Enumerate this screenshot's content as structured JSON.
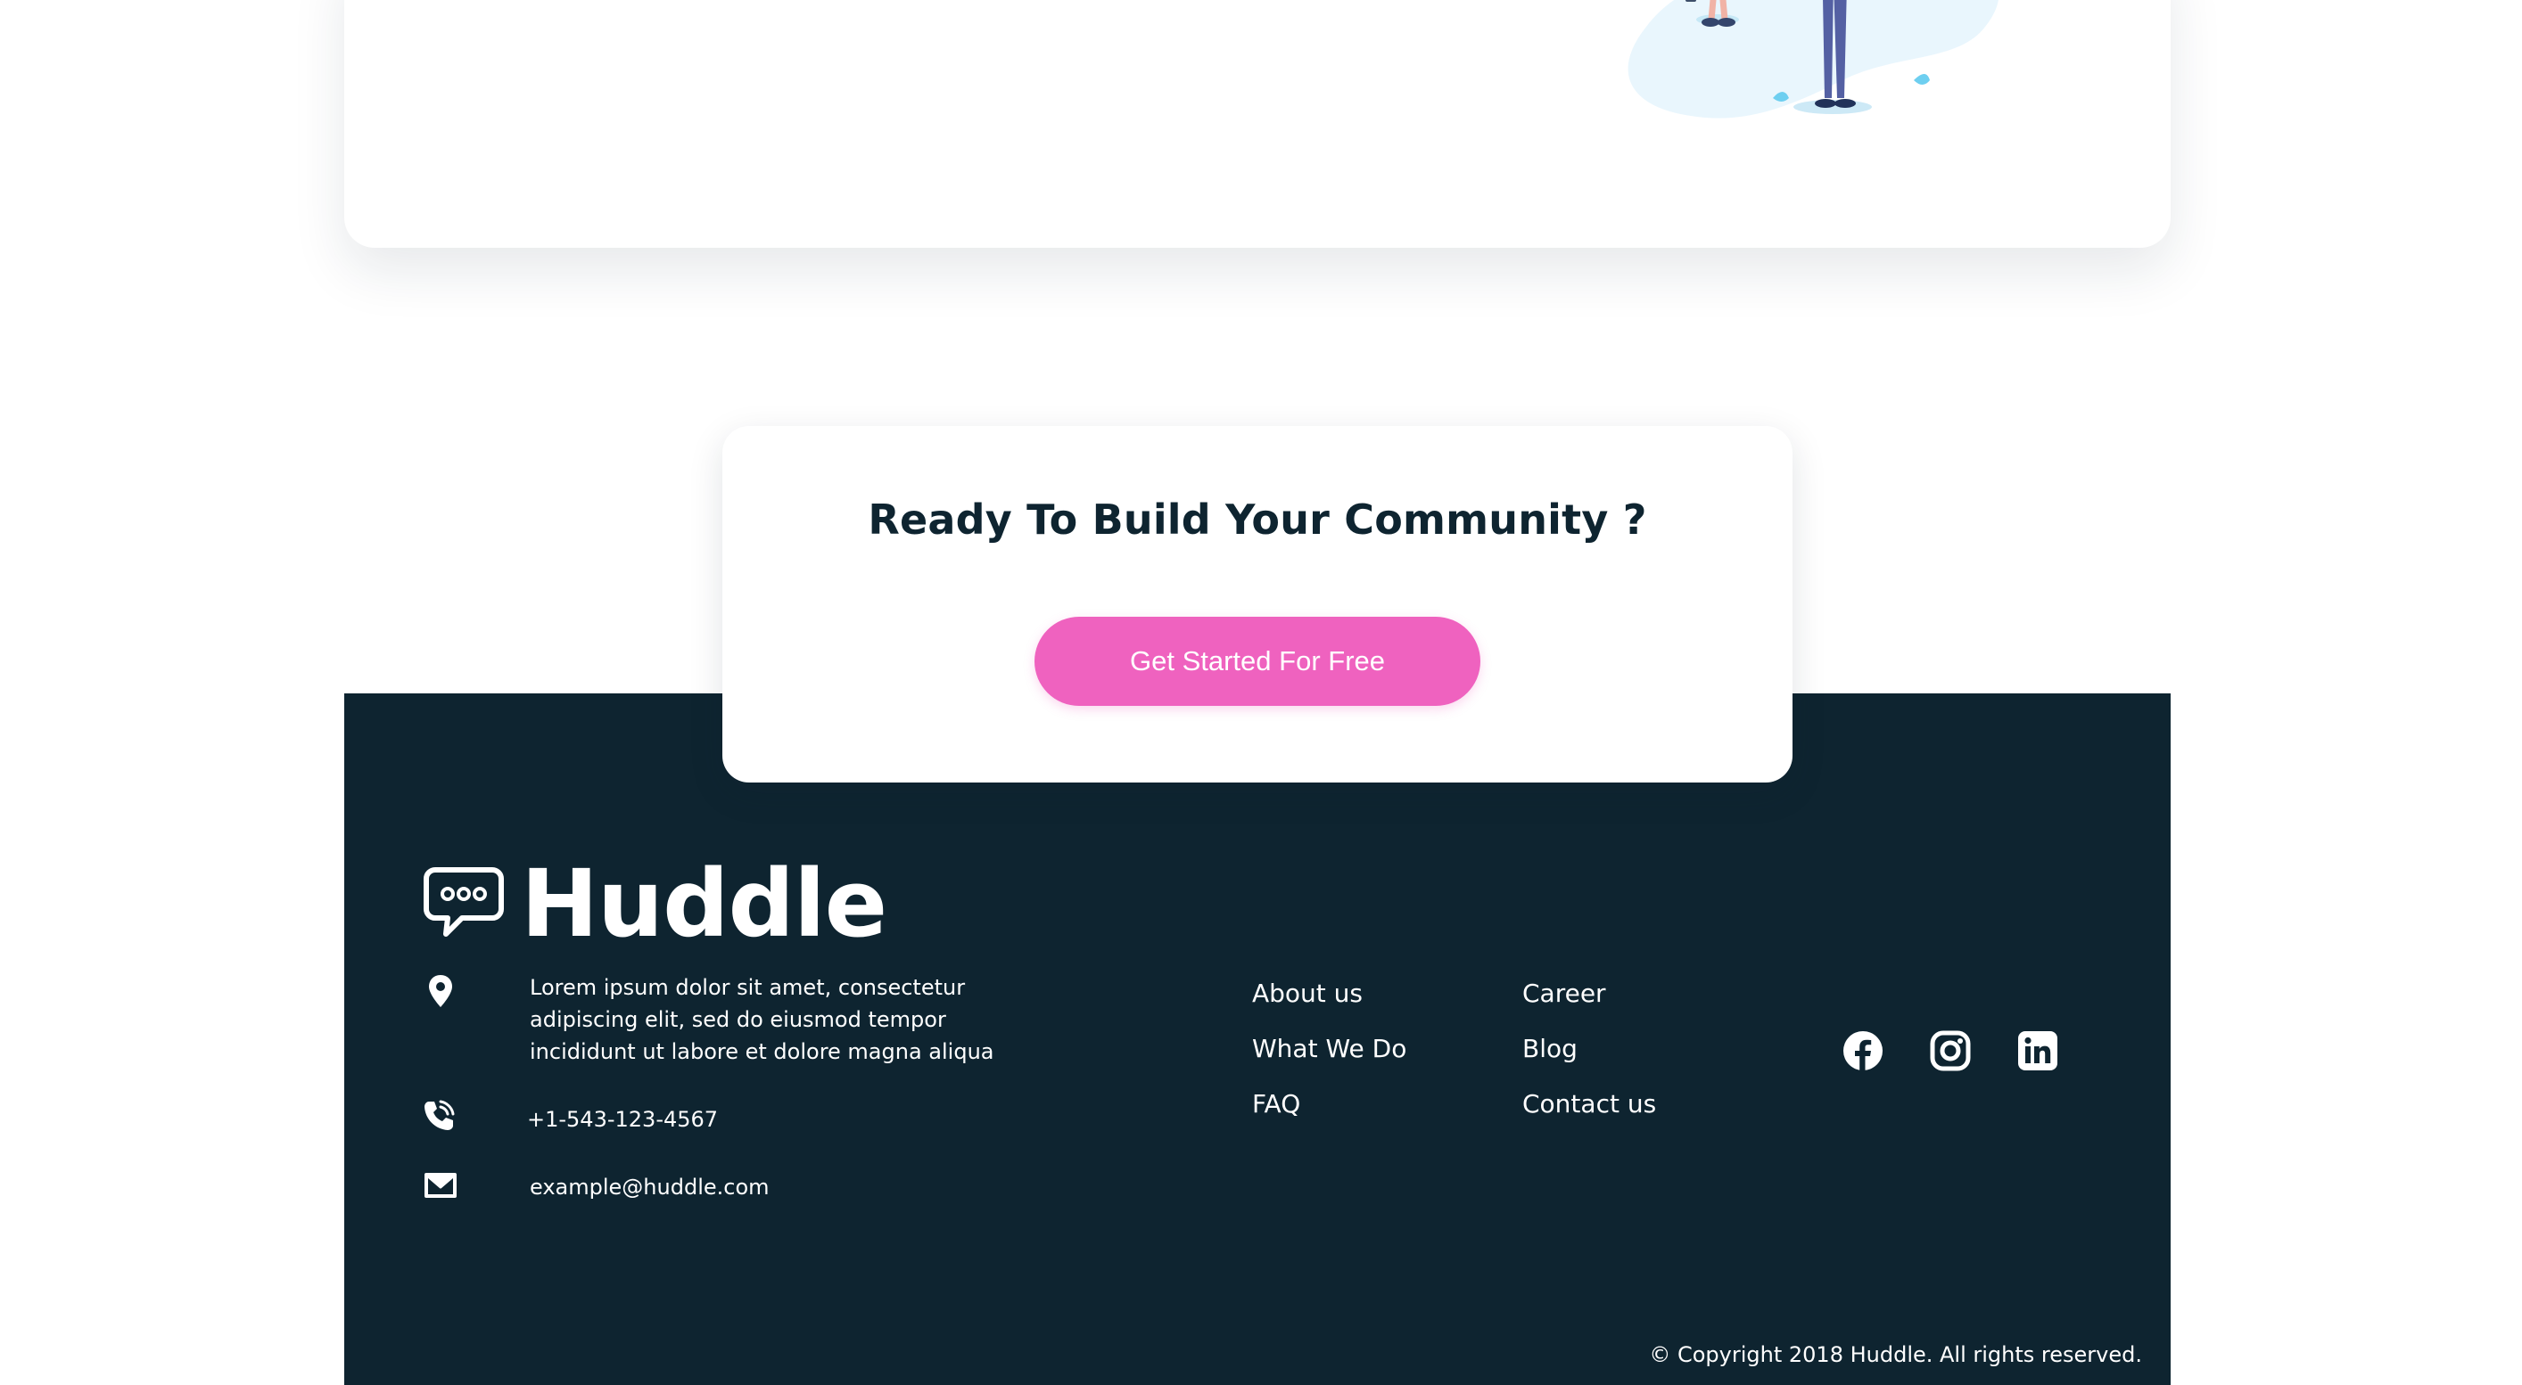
{
  "cta": {
    "title": "Ready To Build Your Community ?",
    "button_label": "Get Started For Free"
  },
  "footer": {
    "logo_text": "Huddle",
    "address": "Lorem ipsum dolor sit amet, consectetur adipiscing elit, sed do eiusmod tempor incididunt ut labore et dolore magna aliqua",
    "phone": "+1-543-123-4567",
    "email": "example@huddle.com",
    "links_col1": [
      "About us",
      "What We Do",
      "FAQ"
    ],
    "links_col2": [
      "Career",
      "Blog",
      "Contact us"
    ],
    "social_icons": [
      "facebook-icon",
      "instagram-icon",
      "linkedin-icon"
    ],
    "copyright": "© Copyright 2018 Huddle. All rights reserved."
  },
  "colors": {
    "footer_bg": "#0e2430",
    "accent_pink": "#ef62bf",
    "heading": "#0e2430",
    "illustration_blob": "#e9f6fd"
  }
}
